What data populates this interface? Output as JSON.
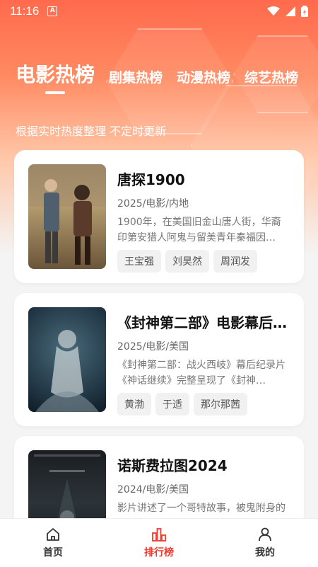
{
  "status_bar": {
    "time": "11:16",
    "notification_icon": "A"
  },
  "tabs": [
    {
      "label": "电影热榜",
      "active": true
    },
    {
      "label": "剧集热榜",
      "active": false
    },
    {
      "label": "动漫热榜",
      "active": false
    },
    {
      "label": "综艺热榜",
      "active": false
    }
  ],
  "subtitle": "根据实时热度整理 不定时更新",
  "cards": [
    {
      "title": "唐探1900",
      "meta": "2025/电影/内地",
      "desc": "1900年，在美国旧金山唐人街，华裔印第安猎人阿鬼与留美青年秦福因…",
      "tags": [
        "王宝强",
        "刘昊然",
        "周润发"
      ]
    },
    {
      "title": "《封神第二部》电影幕后…",
      "meta": "2025/电影/美国",
      "desc": "《封神第二部：战火西岐》幕后纪录片《神话继续》完整呈现了《封神…",
      "tags": [
        "黄渤",
        "于适",
        "那尔那茜"
      ]
    },
    {
      "title": "诺斯费拉图2024",
      "meta": "2024/电影/美国",
      "desc": "影片讲述了一个哥特故事，被鬼附身的年轻女子艾伦·哈特（莉莉-罗丝…",
      "tags": []
    }
  ],
  "bottom_nav": [
    {
      "label": "首页",
      "icon": "home-icon",
      "active": false
    },
    {
      "label": "排行榜",
      "icon": "chart-icon",
      "active": true
    },
    {
      "label": "我的",
      "icon": "profile-icon",
      "active": false
    }
  ],
  "colors": {
    "accent": "#f03a2e",
    "hero_top": "#ff6a4d"
  }
}
